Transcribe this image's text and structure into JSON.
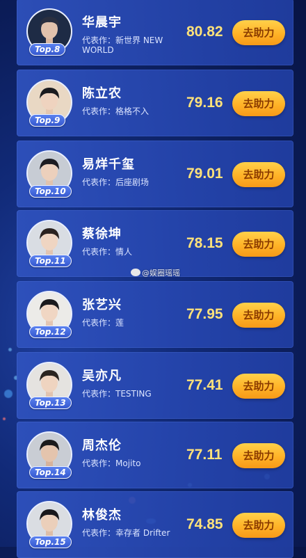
{
  "rows": [
    {
      "rank": "Top.8",
      "name": "华晨宇",
      "work_prefix": "代表作：",
      "work": "新世界 NEW WORLD",
      "score": "80.82",
      "button": "去助力",
      "avatar_bg": "#1e2b45",
      "hair": "#2a2f40",
      "shirt": "#2b3551"
    },
    {
      "rank": "Top.9",
      "name": "陈立农",
      "work_prefix": "代表作：",
      "work": "格格不入",
      "score": "79.16",
      "button": "去助力",
      "avatar_bg": "#e9d8c4",
      "hair": "#1b1b1f",
      "shirt": "#e8e2d8"
    },
    {
      "rank": "Top.10",
      "name": "易烊千玺",
      "work_prefix": "代表作：",
      "work": "后座剧场",
      "score": "79.01",
      "button": "去助力",
      "avatar_bg": "#c7ccd4",
      "hair": "#1c1c22",
      "shirt": "#d8dce2"
    },
    {
      "rank": "Top.11",
      "name": "蔡徐坤",
      "work_prefix": "代表作：",
      "work": "情人",
      "score": "78.15",
      "button": "去助力",
      "avatar_bg": "#d9dde3",
      "hair": "#2a2220",
      "shirt": "#22252c"
    },
    {
      "rank": "Top.12",
      "name": "张艺兴",
      "work_prefix": "代表作：",
      "work": "莲",
      "score": "77.95",
      "button": "去助力",
      "avatar_bg": "#ecebe8",
      "hair": "#1a1a1e",
      "shirt": "#f2f2f2"
    },
    {
      "rank": "Top.13",
      "name": "吴亦凡",
      "work_prefix": "代表作：",
      "work": "TESTING",
      "score": "77.41",
      "button": "去助力",
      "avatar_bg": "#e5e3e0",
      "hair": "#2a2420",
      "shirt": "#e8e8ea"
    },
    {
      "rank": "Top.14",
      "name": "周杰伦",
      "work_prefix": "代表作：",
      "work": "Mojito",
      "score": "77.11",
      "button": "去助力",
      "avatar_bg": "#c9cdd4",
      "hair": "#1a1a1c",
      "shirt": "#23262e"
    },
    {
      "rank": "Top.15",
      "name": "林俊杰",
      "work_prefix": "代表作：",
      "work": "幸存者 Drifter",
      "score": "74.85",
      "button": "去助力",
      "avatar_bg": "#dadde2",
      "hair": "#18181c",
      "shirt": "#2a2d35"
    }
  ],
  "watermark": "@娱圈瑶瑶",
  "colors": {
    "score": "#ffe27a",
    "button": "#ffb227",
    "card": "#2f52be"
  }
}
